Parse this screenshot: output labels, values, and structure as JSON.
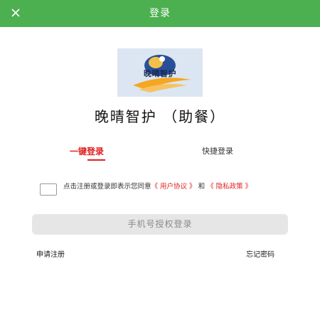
{
  "header": {
    "title": "登录",
    "close_icon": "close-icon",
    "background_color": "#4caf50"
  },
  "logo": {
    "text": "晚晴智护"
  },
  "app_title": "晚晴智护 （助餐）",
  "tabs": [
    {
      "label": "一键登录",
      "active": true
    },
    {
      "label": "快捷登录",
      "active": false
    }
  ],
  "agreement": {
    "checked": false,
    "prefix": "点击注册或登录即表示您同意",
    "user_agreement": "《 用户协议 》",
    "and": "和",
    "privacy_policy": "《 隐私政策 》"
  },
  "login_button": "手机号授权登录",
  "links": {
    "register": "申请注册",
    "forgot_password": "忘记密码"
  },
  "accent_color": "#e02020"
}
